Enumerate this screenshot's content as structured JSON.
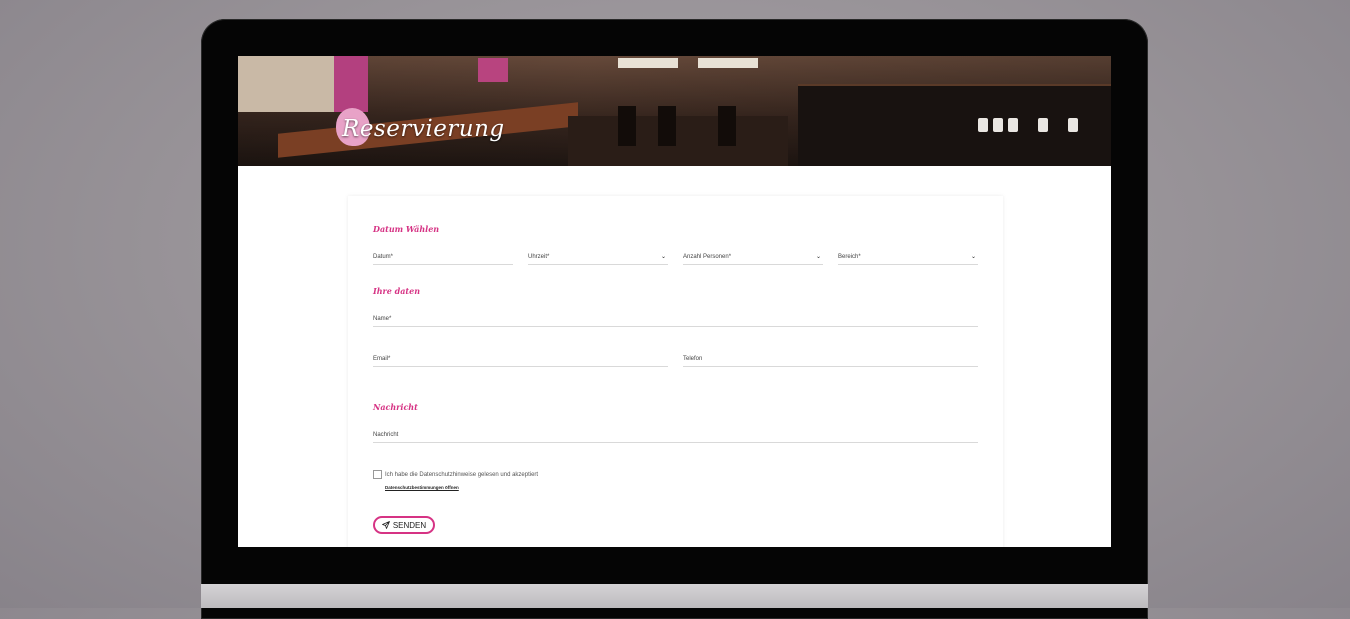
{
  "hero": {
    "title": "Reservierung"
  },
  "form": {
    "section_date": "Datum Wählen",
    "date_label": "Datum*",
    "time_label": "Uhrzeit*",
    "persons_label": "Anzahl Personen*",
    "area_label": "Bereich*",
    "section_details": "Ihre daten",
    "name_label": "Name*",
    "email_label": "Email*",
    "phone_label": "Telefon",
    "section_message": "Nachricht",
    "message_label": "Nachricht",
    "consent_text": "Ich habe die Datenschutzhinweise gelesen und akzeptiert",
    "privacy_link": "Datenschutzbestimmungen öffnen",
    "submit_label": "SENDEN"
  },
  "colors": {
    "accent": "#d63384",
    "background": "#979297"
  },
  "icons": {
    "dropdown": "chevron-down-icon",
    "submit": "send-icon"
  }
}
